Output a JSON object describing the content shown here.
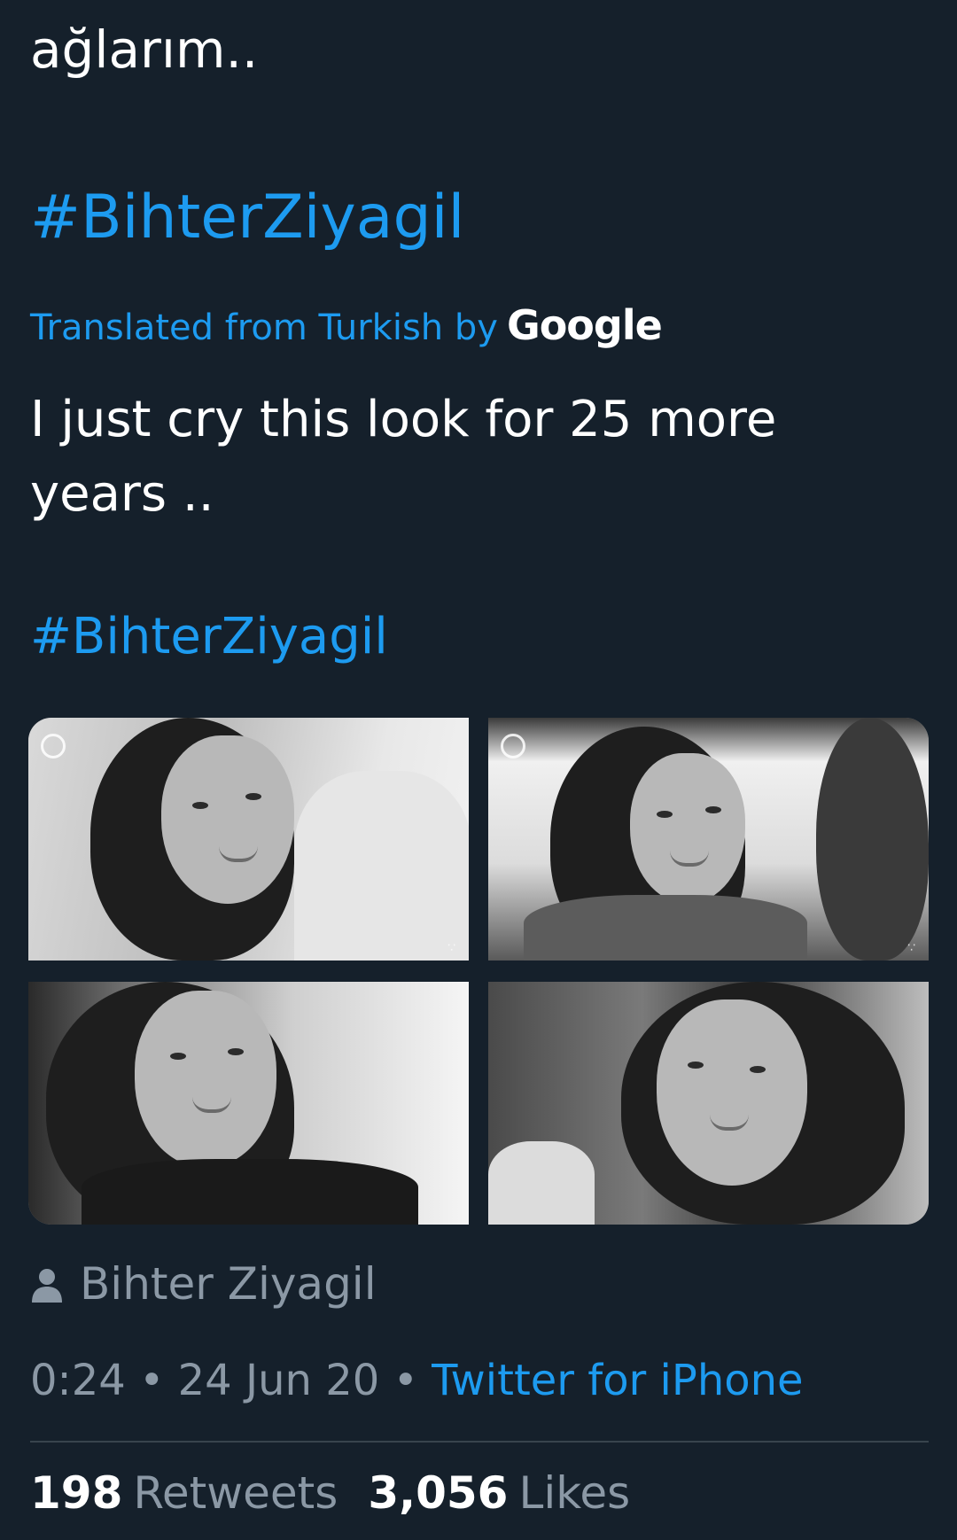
{
  "tweet": {
    "original_text": "ağlarım..",
    "hashtag_original": "#BihterZiyagil",
    "translation_notice": "Translated from Turkish by",
    "translation_provider": "Google",
    "translated_text": "I just cry this look for 25 more years ..",
    "hashtag_translated": "#BihterZiyagil",
    "author_name": "Bihter Ziyagil",
    "time": "0:24",
    "separator": "•",
    "date": "24 Jun 20",
    "source": "Twitter for iPhone",
    "retweets_count": "198",
    "retweets_label": "Retweets",
    "likes_count": "3,056",
    "likes_label": "Likes"
  },
  "media": {
    "photos": [
      {
        "icon": "person-icon"
      },
      {
        "icon": "person-icon"
      },
      {
        "icon": "person-icon"
      },
      {
        "icon": "person-icon"
      }
    ]
  },
  "colors": {
    "background": "#15202b",
    "accent": "#1d9bf0",
    "secondary_text": "#8b98a5",
    "divider": "#38444d"
  }
}
